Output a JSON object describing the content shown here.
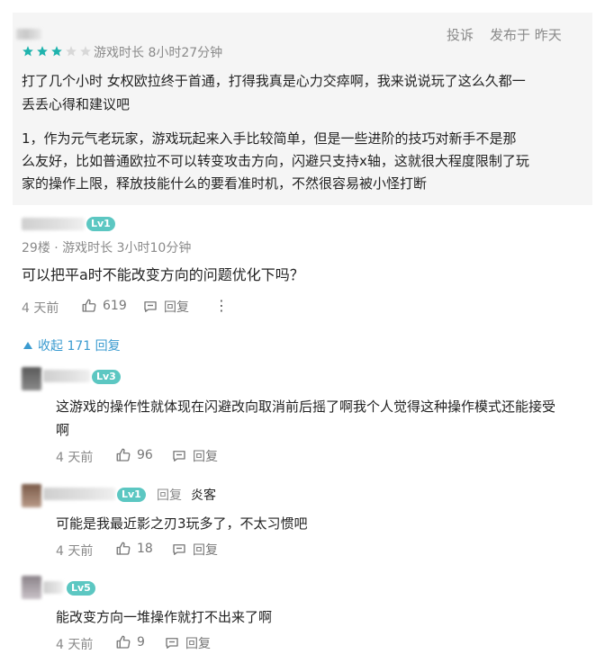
{
  "review": {
    "rating": 3,
    "rating_max": 5,
    "play_time": "游戏时长 8小时27分钟",
    "actions": {
      "report": "投诉",
      "posted": "发布于 昨天"
    },
    "paragraph1_line1": "打了几个小时 女权欧拉终于首通，打得我真是心力交瘁啊，我来说说玩了这么久都一",
    "paragraph1_line2": "丢丢心得和建议吧",
    "paragraph2_line1": "1，作为元气老玩家，游戏玩起来入手比较简单，但是一些进阶的技巧对新手不是那",
    "paragraph2_line2": "么友好，比如普通欧拉不可以转变攻击方向，闪避只支持x轴，这就很大程度限制了玩",
    "paragraph2_line3": "家的操作上限，释放技能什么的要看准时机，不然很容易被小怪打断"
  },
  "floor_comment": {
    "level": "Lv1",
    "meta": "29楼 · 游戏时长 3小时10分钟",
    "text": "可以把平a时不能改变方向的问题优化下吗？",
    "time": "4 天前",
    "likes": "619",
    "reply_label": "回复",
    "more": "⋮"
  },
  "collapse_label": "收起 171 回复",
  "replies": [
    {
      "level": "Lv3",
      "line1": "这游戏的操作性就体现在闪避改向取消前后摇了啊我个人觉得这种操作模式还能接受",
      "line2": "啊",
      "time": "4 天前",
      "likes": "96",
      "reply_label": "回复"
    },
    {
      "level": "Lv1",
      "reply_to_label": "回复",
      "reply_to_name": "炎客",
      "line1": "可能是我最近影之刃3玩多了，不太习惯吧",
      "time": "4 天前",
      "likes": "18",
      "reply_label": "回复"
    },
    {
      "level": "Lv5",
      "line1": "能改变方向一堆操作就打不出来了啊",
      "time": "4 天前",
      "likes": "9",
      "reply_label": "回复"
    }
  ],
  "colors": {
    "star_filled": "#1fb3ad",
    "star_empty": "#d8d8d8",
    "level_badge": "#5cc7c2",
    "link_blue": "#3b9bd0"
  }
}
